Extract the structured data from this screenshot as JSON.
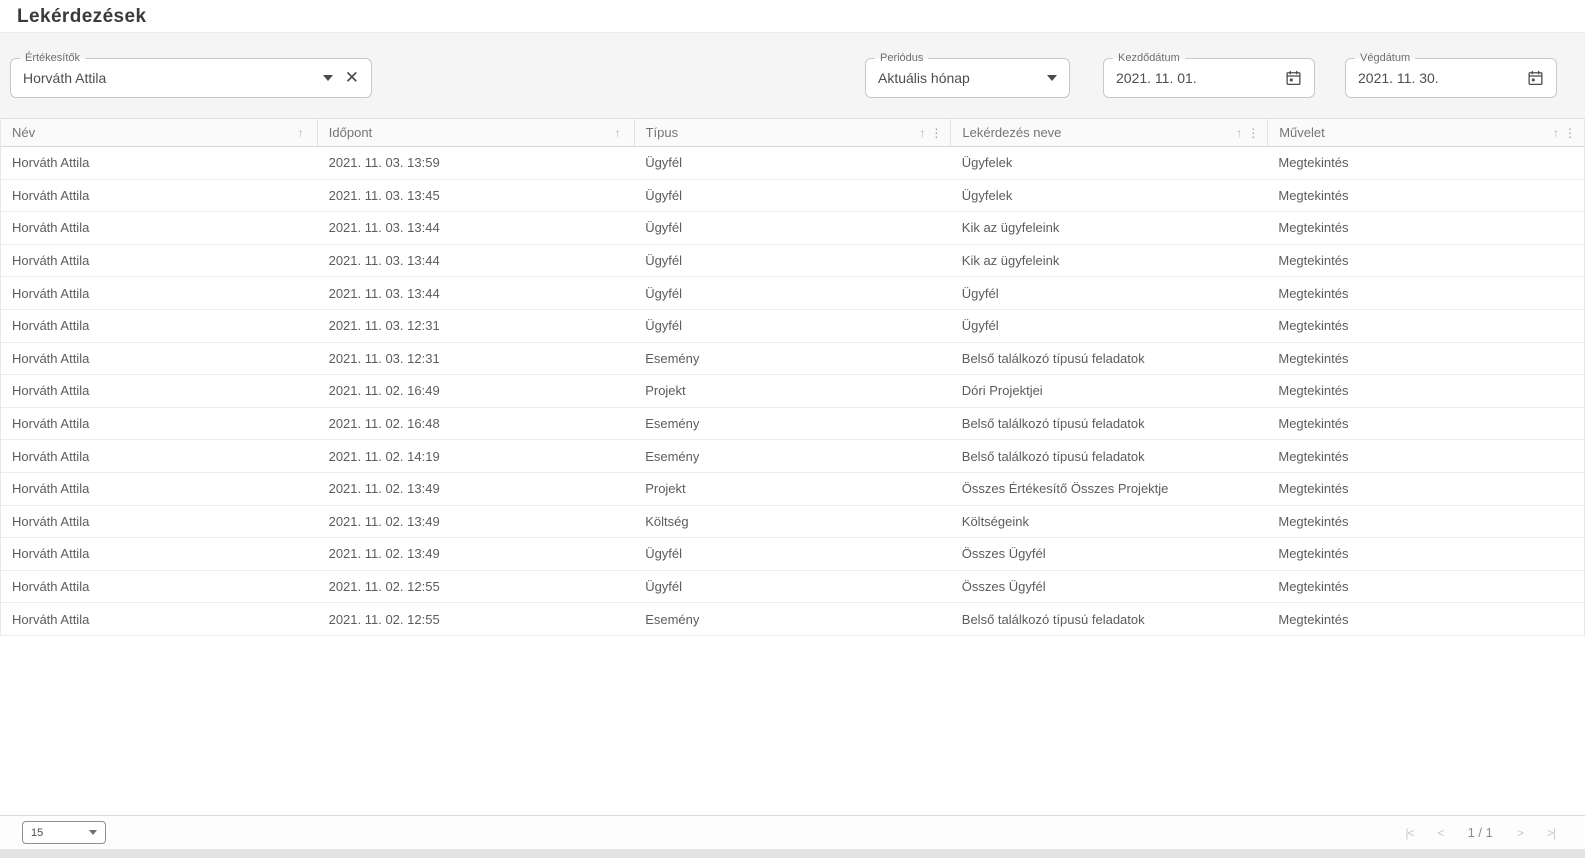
{
  "page": {
    "title": "Lekérdezések"
  },
  "filters": {
    "salespeople": {
      "label": "Értékesítők",
      "value": "Horváth Attila"
    },
    "period": {
      "label": "Periódus",
      "value": "Aktuális hónap"
    },
    "start_date": {
      "label": "Kezdődátum",
      "value": "2021. 11. 01."
    },
    "end_date": {
      "label": "Végdátum",
      "value": "2021. 11. 30."
    }
  },
  "table": {
    "columns": [
      "Név",
      "Időpont",
      "Típus",
      "Lekérdezés neve",
      "Művelet"
    ],
    "sort_icon": "↑",
    "menu_icon": "⋮",
    "rows": [
      {
        "name": "Horváth Attila",
        "time": "2021. 11. 03. 13:59",
        "type": "Ügyfél",
        "query": "Ügyfelek",
        "action": "Megtekintés"
      },
      {
        "name": "Horváth Attila",
        "time": "2021. 11. 03. 13:45",
        "type": "Ügyfél",
        "query": "Ügyfelek",
        "action": "Megtekintés"
      },
      {
        "name": "Horváth Attila",
        "time": "2021. 11. 03. 13:44",
        "type": "Ügyfél",
        "query": "Kik az ügyfeleink",
        "action": "Megtekintés"
      },
      {
        "name": "Horváth Attila",
        "time": "2021. 11. 03. 13:44",
        "type": "Ügyfél",
        "query": "Kik az ügyfeleink",
        "action": "Megtekintés"
      },
      {
        "name": "Horváth Attila",
        "time": "2021. 11. 03. 13:44",
        "type": "Ügyfél",
        "query": "Ügyfél",
        "action": "Megtekintés"
      },
      {
        "name": "Horváth Attila",
        "time": "2021. 11. 03. 12:31",
        "type": "Ügyfél",
        "query": "Ügyfél",
        "action": "Megtekintés"
      },
      {
        "name": "Horváth Attila",
        "time": "2021. 11. 03. 12:31",
        "type": "Esemény",
        "query": "Belső találkozó típusú feladatok",
        "action": "Megtekintés"
      },
      {
        "name": "Horváth Attila",
        "time": "2021. 11. 02. 16:49",
        "type": "Projekt",
        "query": "Dóri Projektjei",
        "action": "Megtekintés"
      },
      {
        "name": "Horváth Attila",
        "time": "2021. 11. 02. 16:48",
        "type": "Esemény",
        "query": "Belső találkozó típusú feladatok",
        "action": "Megtekintés"
      },
      {
        "name": "Horváth Attila",
        "time": "2021. 11. 02. 14:19",
        "type": "Esemény",
        "query": "Belső találkozó típusú feladatok",
        "action": "Megtekintés"
      },
      {
        "name": "Horváth Attila",
        "time": "2021. 11. 02. 13:49",
        "type": "Projekt",
        "query": "Összes Értékesítő Összes Projektje",
        "action": "Megtekintés"
      },
      {
        "name": "Horváth Attila",
        "time": "2021. 11. 02. 13:49",
        "type": "Költség",
        "query": "Költségeink",
        "action": "Megtekintés"
      },
      {
        "name": "Horváth Attila",
        "time": "2021. 11. 02. 13:49",
        "type": "Ügyfél",
        "query": "Összes Ügyfél",
        "action": "Megtekintés"
      },
      {
        "name": "Horváth Attila",
        "time": "2021. 11. 02. 12:55",
        "type": "Ügyfél",
        "query": "Összes Ügyfél",
        "action": "Megtekintés"
      },
      {
        "name": "Horváth Attila",
        "time": "2021. 11. 02. 12:55",
        "type": "Esemény",
        "query": "Belső találkozó típusú feladatok",
        "action": "Megtekintés"
      }
    ]
  },
  "footer": {
    "page_size": "15",
    "page_indicator": "1 / 1",
    "pager_icons": {
      "first": "|<",
      "prev": "<",
      "next": ">",
      "last": ">|"
    }
  },
  "colors": {
    "panel_bg": "#f5f5f5",
    "header_bg": "#fafafa",
    "border": "#e0e0e0",
    "text": "#5c5c5c",
    "muted": "#9e9e9e"
  }
}
